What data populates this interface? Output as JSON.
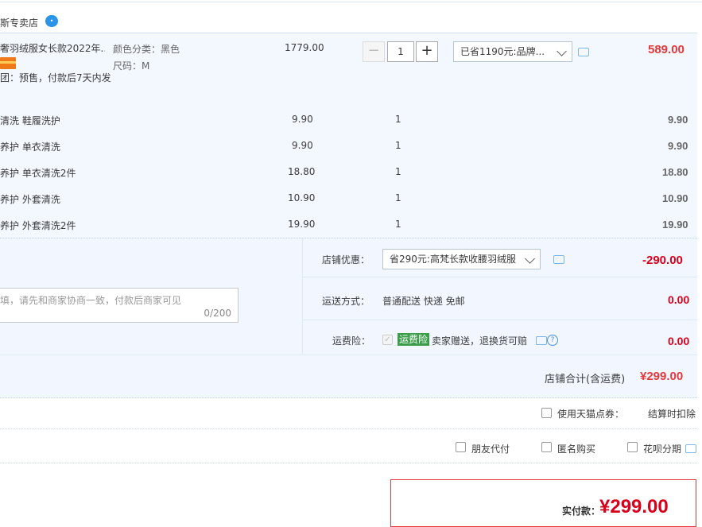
{
  "store": {
    "name": "斯专卖店",
    "badge_icon": "wangwang-icon"
  },
  "main_item": {
    "title": "奢羽绒服女长款2022年...",
    "presale": "团：预售，付款后7天内发",
    "attr_color": "颜色分类：黑色",
    "attr_size": "尺码：M",
    "unit_price": "1779.00",
    "qty": "1",
    "discount_select": "已省1190元:品牌...",
    "subtotal": "589.00"
  },
  "services": [
    {
      "name": "清洗 鞋履洗护",
      "price": "9.90",
      "qty": "1",
      "subtotal": "9.90"
    },
    {
      "name": "养护 单衣清洗",
      "price": "9.90",
      "qty": "1",
      "subtotal": "9.90"
    },
    {
      "name": "养护 单衣清洗2件",
      "price": "18.80",
      "qty": "1",
      "subtotal": "18.80"
    },
    {
      "name": "养护 外套清洗",
      "price": "10.90",
      "qty": "1",
      "subtotal": "10.90"
    },
    {
      "name": "养护 外套清洗2件",
      "price": "19.90",
      "qty": "1",
      "subtotal": "19.90"
    }
  ],
  "message": {
    "placeholder": "填，请先和商家协商一致，付款后商家可见",
    "counter": "0/200"
  },
  "store_discount": {
    "label": "店铺优惠：",
    "select": "省290元:高梵长款收腰羽绒服",
    "amount": "-290.00"
  },
  "shipping": {
    "label": "运送方式：",
    "value": "普通配送 快递 免邮",
    "amount": "0.00"
  },
  "insurance": {
    "label": "运费险：",
    "tag": "运费险",
    "desc": "卖家赠送，退换货可赔",
    "amount": "0.00"
  },
  "store_total": {
    "label": "店铺合计(含运费)",
    "amount": "¥299.00"
  },
  "coupon": {
    "label": "使用天猫点券：",
    "note": "结算时扣除"
  },
  "options": {
    "friend_pay": "朋友代付",
    "anonymous": "匿名购买",
    "huabei": "花呗分期"
  },
  "pay": {
    "label": "实付款：",
    "amount": "¥299.00"
  },
  "colors": {
    "accent_orange": "#e4393c",
    "price_red": "#d9001b",
    "border_blue": "#b7d3f2",
    "tag_green": "#3a9d4a"
  }
}
